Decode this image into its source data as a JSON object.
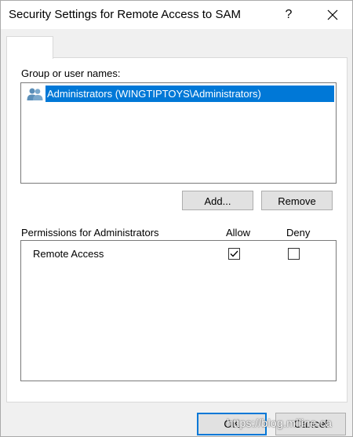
{
  "window": {
    "title": "Security Settings for Remote Access to SAM",
    "help_label": "?"
  },
  "tabs": [
    {
      "label": ""
    }
  ],
  "group_section": {
    "label": "Group or user names:",
    "items": [
      {
        "label": "Administrators (WINGTIPTOYS\\Administrators)",
        "selected": true,
        "icon": "users-group-icon"
      }
    ],
    "add_label": "Add...",
    "remove_label": "Remove"
  },
  "permissions": {
    "header_label": "Permissions for Administrators",
    "allow_label": "Allow",
    "deny_label": "Deny",
    "rows": [
      {
        "label": "Remote Access",
        "allow": true,
        "deny": false
      }
    ]
  },
  "footer": {
    "ok_label": "OK",
    "cancel_label": "Cancel"
  },
  "watermark": "https://blog.mlline.ca",
  "colors": {
    "selection": "#0078d7",
    "default_button_border": "#0078d7"
  }
}
